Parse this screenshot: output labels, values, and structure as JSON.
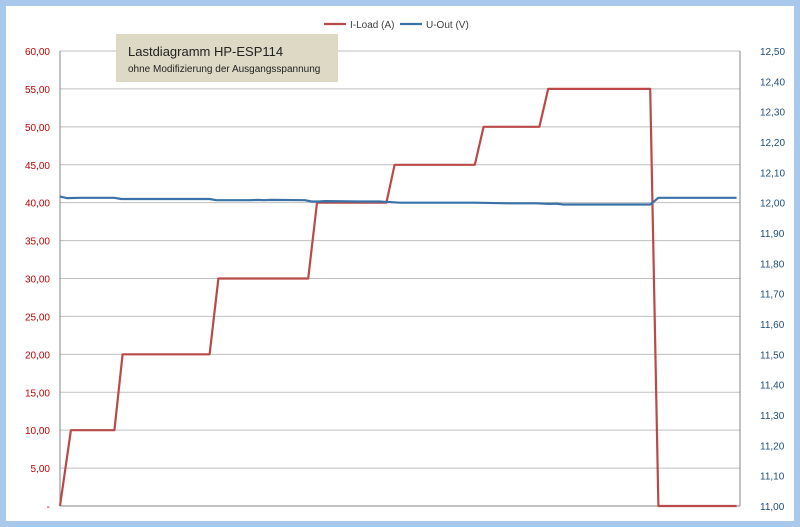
{
  "chart_data": {
    "type": "line",
    "title": "Lastdiagramm HP-ESP114",
    "subtitle": "ohne Modifizierung der Ausgangsspannung",
    "grid": true,
    "legend_position": "top-center",
    "y_left": {
      "range": [
        0,
        60
      ],
      "ticks": [
        "-",
        "5,00",
        "10,00",
        "15,00",
        "20,00",
        "25,00",
        "30,00",
        "35,00",
        "40,00",
        "45,00",
        "50,00",
        "55,00",
        "60,00"
      ],
      "color": "#c00000"
    },
    "y_right": {
      "range": [
        11.0,
        12.5
      ],
      "ticks": [
        "11,00",
        "11,10",
        "11,20",
        "11,30",
        "11,40",
        "11,50",
        "11,60",
        "11,70",
        "11,80",
        "11,90",
        "12,00",
        "12,10",
        "12,20",
        "12,30",
        "12,40",
        "12,50"
      ],
      "color": "#1f4e79"
    },
    "x_range": [
      0,
      100
    ],
    "series": [
      {
        "name": "I-Load (A)",
        "axis": "left",
        "color": "#b94a48",
        "points": [
          [
            0,
            0
          ],
          [
            1.6,
            10
          ],
          [
            8,
            10
          ],
          [
            9.2,
            20
          ],
          [
            22,
            20
          ],
          [
            23.3,
            30
          ],
          [
            36.5,
            30
          ],
          [
            37.8,
            40
          ],
          [
            48,
            40
          ],
          [
            49.2,
            45
          ],
          [
            61,
            45
          ],
          [
            62.3,
            50
          ],
          [
            70.5,
            50
          ],
          [
            71.8,
            55
          ],
          [
            86.8,
            55
          ],
          [
            88,
            0
          ],
          [
            99.5,
            0
          ]
        ]
      },
      {
        "name": "U-Out (V)",
        "axis": "right",
        "color": "#3a72a8",
        "points": [
          [
            0,
            12.02
          ],
          [
            1,
            12.015
          ],
          [
            3,
            12.016
          ],
          [
            8,
            12.016
          ],
          [
            9,
            12.012
          ],
          [
            22,
            12.012
          ],
          [
            23,
            12.008
          ],
          [
            28,
            12.008
          ],
          [
            29,
            12.009
          ],
          [
            30,
            12.008
          ],
          [
            31,
            12.009
          ],
          [
            36,
            12.008
          ],
          [
            37,
            12.004
          ],
          [
            38,
            12.004
          ],
          [
            39,
            12.005
          ],
          [
            44,
            12.004
          ],
          [
            47,
            12.004
          ],
          [
            50,
            12.0
          ],
          [
            61,
            12.0
          ],
          [
            66,
            11.998
          ],
          [
            70,
            11.998
          ],
          [
            72,
            11.996
          ],
          [
            73,
            11.997
          ],
          [
            74,
            11.994
          ],
          [
            86.8,
            11.994
          ],
          [
            88,
            12.016
          ],
          [
            99.5,
            12.016
          ]
        ]
      }
    ]
  }
}
